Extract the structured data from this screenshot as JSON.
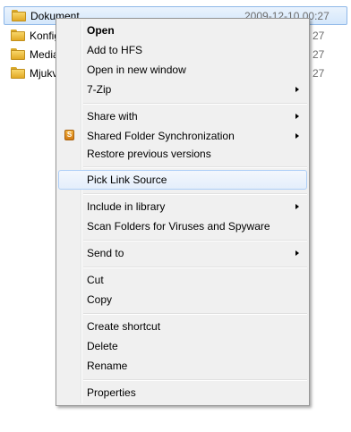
{
  "explorer": {
    "files": [
      {
        "name": "Dokument",
        "date": "2009-12-10 00:27"
      },
      {
        "name": "Konfig",
        "date": "27"
      },
      {
        "name": "Media",
        "date": "27"
      },
      {
        "name": "Mjukv",
        "date": "27"
      }
    ]
  },
  "context_menu": {
    "items": {
      "open": "Open",
      "add_to_hfs": "Add to HFS",
      "open_new_window": "Open in new window",
      "seven_zip": "7-Zip",
      "share_with": "Share with",
      "shared_folder_sync": "Shared Folder Synchronization",
      "restore_versions": "Restore previous versions",
      "pick_link_source": "Pick Link Source",
      "include_in_library": "Include in library",
      "scan_folders": "Scan Folders for Viruses and Spyware",
      "send_to": "Send to",
      "cut": "Cut",
      "copy": "Copy",
      "create_shortcut": "Create shortcut",
      "delete": "Delete",
      "rename": "Rename",
      "properties": "Properties"
    },
    "icons": {
      "shared_folder_sync": "shared-folder-sync-icon"
    }
  }
}
